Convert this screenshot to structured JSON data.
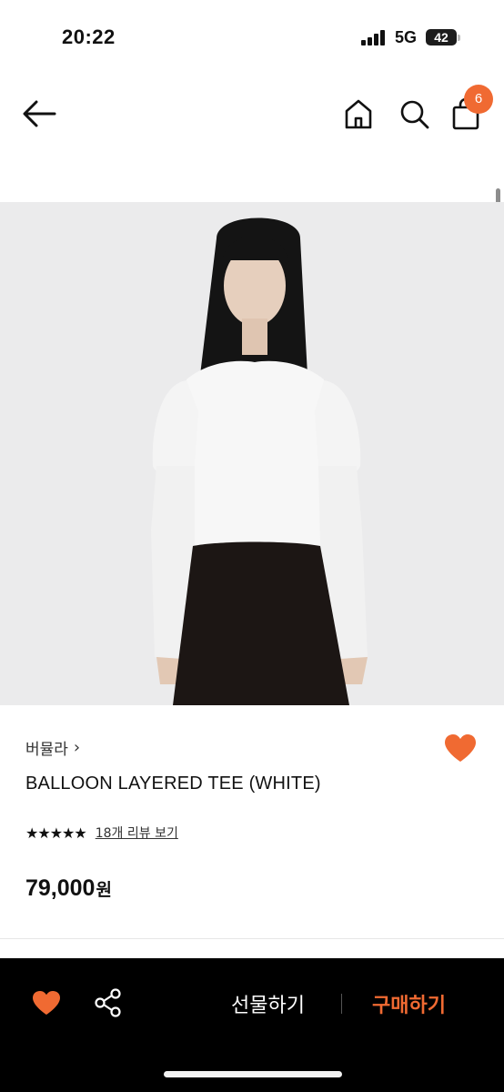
{
  "status": {
    "time": "20:22",
    "network": "5G",
    "battery": "42"
  },
  "nav": {
    "cart_count": "6"
  },
  "product": {
    "brand": "버뮬라",
    "name": "BALLOON LAYERED TEE (WHITE)",
    "rating": 5,
    "review_link": "18개 리뷰 보기",
    "price": "79,000",
    "currency": "원",
    "wishlisted": true
  },
  "actions": {
    "gift": "선물하기",
    "buy": "구매하기"
  },
  "colors": {
    "accent": "#f06a32",
    "bottom_bar": "#000000"
  }
}
